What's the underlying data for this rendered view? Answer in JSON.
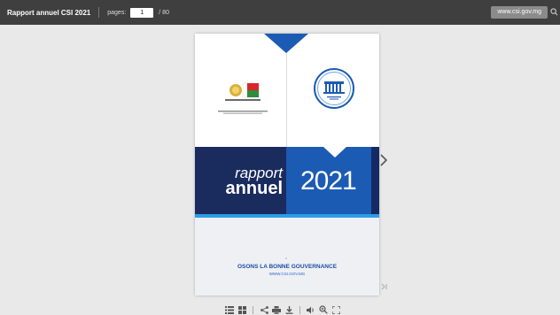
{
  "toolbar": {
    "doc_title": "Rapport annuel CSI 2021",
    "pages_label": "pages:",
    "current_page": "1",
    "total_pages": "/ 80",
    "site_link": "www.csi.gov.mg"
  },
  "cover": {
    "rapport_word": "rapport",
    "annuel_word": "annuel",
    "year": "2021",
    "slogan": "OSONS LA BONNE GOUVERNANCE",
    "website": "WWW.CSI.GOV.MG"
  },
  "icons": {
    "search": "search-icon",
    "next": "chevron-right-icon",
    "last": "last-page-icon",
    "toc": "list-icon",
    "thumbs": "grid-icon",
    "share": "share-icon",
    "print": "print-icon",
    "download": "download-icon",
    "sound": "speaker-icon",
    "zoom": "zoom-in-icon",
    "fullscreen": "fullscreen-icon"
  },
  "colors": {
    "topbar": "#3f3f3f",
    "navy": "#1a2b5e",
    "blue": "#1c5bb3",
    "cyan": "#2a9ee8",
    "slogan": "#1f4da6"
  }
}
